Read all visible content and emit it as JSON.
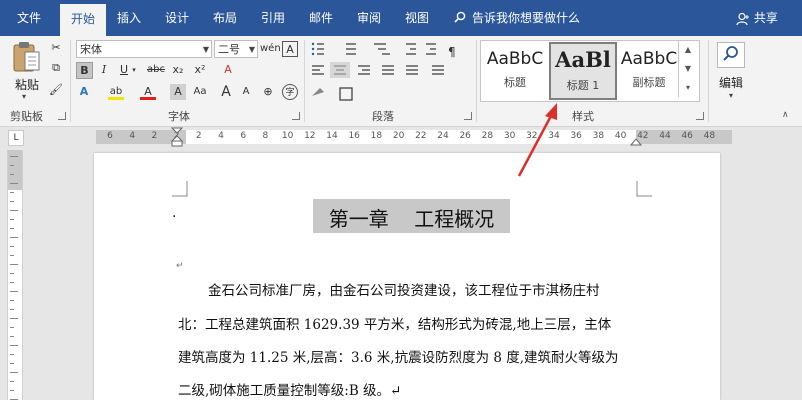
{
  "tabs": [
    "文件",
    "开始",
    "插入",
    "设计",
    "布局",
    "引用",
    "邮件",
    "审阅",
    "视图"
  ],
  "tell_me": "告诉我你想要做什么",
  "share": "共享",
  "clipboard": {
    "paste": "粘贴",
    "group": "剪贴板"
  },
  "font": {
    "name": "宋体",
    "size": "二号",
    "group": "字体",
    "buttons": {
      "bold": "B",
      "italic": "I",
      "underline": "U",
      "strike": "abc",
      "subscript": "x₂",
      "superscript": "x²",
      "clear": "A",
      "effects": "A",
      "highlight": "ab",
      "color": "A",
      "shade": "A",
      "grow": "A",
      "shrink": "A",
      "case": "Aa",
      "phonetic": "wén",
      "border": "A"
    }
  },
  "paragraph": {
    "group": "段落"
  },
  "styles": {
    "group": "样式",
    "items": [
      {
        "sample": "AaBbC",
        "name": "标题"
      },
      {
        "sample": "AaBl",
        "name": "标题 1"
      },
      {
        "sample": "AaBbC",
        "name": "副标题"
      }
    ]
  },
  "editing": {
    "label": "编辑"
  },
  "ruler_ticks": [
    "6",
    "4",
    "2",
    "2",
    "2",
    "4",
    "6",
    "8",
    "10",
    "12",
    "14",
    "16",
    "18",
    "20",
    "22",
    "24",
    "26",
    "28",
    "30",
    "32",
    "34",
    "36",
    "38",
    "40",
    "42",
    "44",
    "46",
    "48"
  ],
  "ruler_tab_selector": "L",
  "document": {
    "title": "第一章    工程概况",
    "para_mark": "↵",
    "lines": [
      "金石公司标准厂房，由金石公司投资建设，该工程位于市淇杨庄村",
      "北：工程总建筑面积 1629.39 平方米，结构形式为砖混,地上三层，主体",
      "建筑高度为 11.25 米,层高：3.6 米,抗震设防烈度为 8 度,建筑耐火等级为",
      "二级,砌体施工质量控制等级:B 级。↵"
    ]
  },
  "colors": {
    "brand": "#2b579a",
    "arrow": "#d9302c",
    "highlight": "#c8c8c8"
  }
}
